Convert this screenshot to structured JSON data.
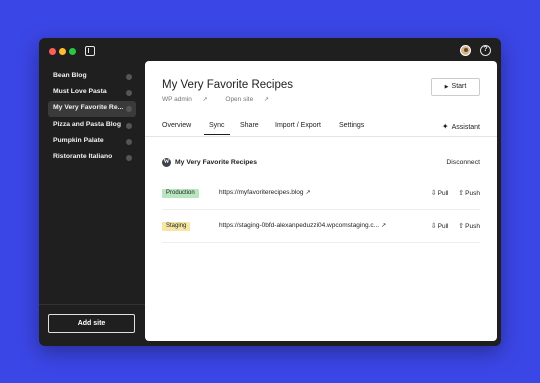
{
  "window": {
    "accent": "#3b46e6"
  },
  "sidebar": {
    "items": [
      {
        "label": "Bean Blog",
        "active": false
      },
      {
        "label": "Must Love Pasta",
        "active": false
      },
      {
        "label": "My Very Favorite Re...",
        "active": true
      },
      {
        "label": "Pizza and Pasta Blog",
        "active": false
      },
      {
        "label": "Pumpkin Palate",
        "active": false
      },
      {
        "label": "Ristorante Italiano",
        "active": false
      }
    ],
    "add_site_label": "Add site"
  },
  "main": {
    "title": "My Very Favorite Recipes",
    "wp_admin_label": "WP admin",
    "open_site_label": "Open site",
    "start_label": "Start",
    "tabs": [
      {
        "label": "Overview"
      },
      {
        "label": "Sync",
        "active": true
      },
      {
        "label": "Share"
      },
      {
        "label": "Import / Export"
      },
      {
        "label": "Settings"
      }
    ],
    "assistant_label": "Assistant",
    "connection": {
      "label": "My Very Favorite Recipes",
      "disconnect_label": "Disconnect"
    },
    "environments": [
      {
        "badge": "Production",
        "url": "https://myfavoriterecipes.blog",
        "pull_label": "Pull",
        "push_label": "Push"
      },
      {
        "badge": "Staging",
        "url": "https://staging-0bfd-alexanpeduzzi04.wpcomstaging.c...",
        "pull_label": "Pull",
        "push_label": "Push"
      }
    ]
  }
}
